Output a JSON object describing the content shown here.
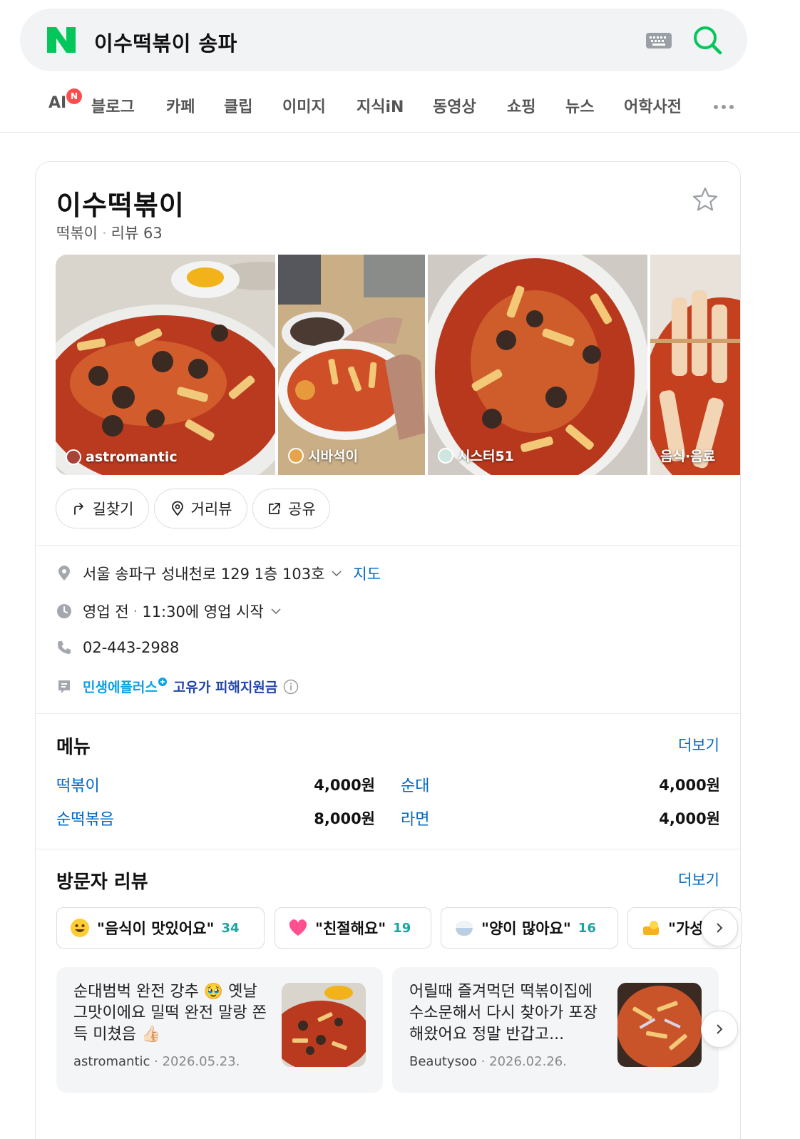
{
  "search": {
    "query": "이수떡볶이 송파"
  },
  "tabs": [
    {
      "label": "AI",
      "badge": "N"
    },
    {
      "label": "블로그"
    },
    {
      "label": "카페"
    },
    {
      "label": "클립"
    },
    {
      "label": "이미지"
    },
    {
      "label": "지식iN"
    },
    {
      "label": "동영상"
    },
    {
      "label": "쇼핑"
    },
    {
      "label": "뉴스"
    },
    {
      "label": "어학사전"
    }
  ],
  "place": {
    "name": "이수떡볶이",
    "category": "떡볶이",
    "review_label": "리뷰 63",
    "photos": [
      {
        "author": "astromantic"
      },
      {
        "author": "시바석이"
      },
      {
        "author": "시스터51"
      },
      {
        "author": "음식·음료"
      }
    ],
    "actions": {
      "directions": "길찾기",
      "streetview": "거리뷰",
      "share": "공유"
    },
    "address": "서울 송파구 성내천로 129 1층 103호",
    "map_link": "지도",
    "hours_status": "영업 전",
    "hours_detail": "11:30에 영업 시작",
    "phone": "02-443-2988",
    "minsaeng_a": "민생에플러스",
    "minsaeng_b": "고유가 피해지원금"
  },
  "menu": {
    "title": "메뉴",
    "more": "더보기",
    "items": [
      {
        "name": "떡볶이",
        "price": "4,000원"
      },
      {
        "name": "순대",
        "price": "4,000원"
      },
      {
        "name": "순떡볶음",
        "price": "8,000원"
      },
      {
        "name": "라면",
        "price": "4,000원"
      }
    ]
  },
  "reviews": {
    "title": "방문자 리뷰",
    "more": "더보기",
    "keywords": [
      {
        "label": "\"음식이 맛있어요\"",
        "count": "34"
      },
      {
        "label": "\"친절해요\"",
        "count": "19"
      },
      {
        "label": "\"양이 많아요\"",
        "count": "16"
      },
      {
        "label": "\"가성",
        "count": ""
      }
    ],
    "items": [
      {
        "text": "순대범벅 완전 강추 🥹 옛날 그맛이에요 밀떡 완전 말랑 쫀득 미쳤음 👍🏻",
        "author": "astromantic",
        "date": "2026.05.23."
      },
      {
        "text": "어릴때 즐겨먹던 떡볶이집에 수소문해서 다시 찾아가 포장해왔어요 정말 반갑고...",
        "author": "Beautysoo",
        "date": "2026.02.26."
      }
    ]
  },
  "colors": {
    "brand_green": "#03c75a",
    "link_blue": "#0068c3",
    "count_teal": "#1aa5a5"
  }
}
